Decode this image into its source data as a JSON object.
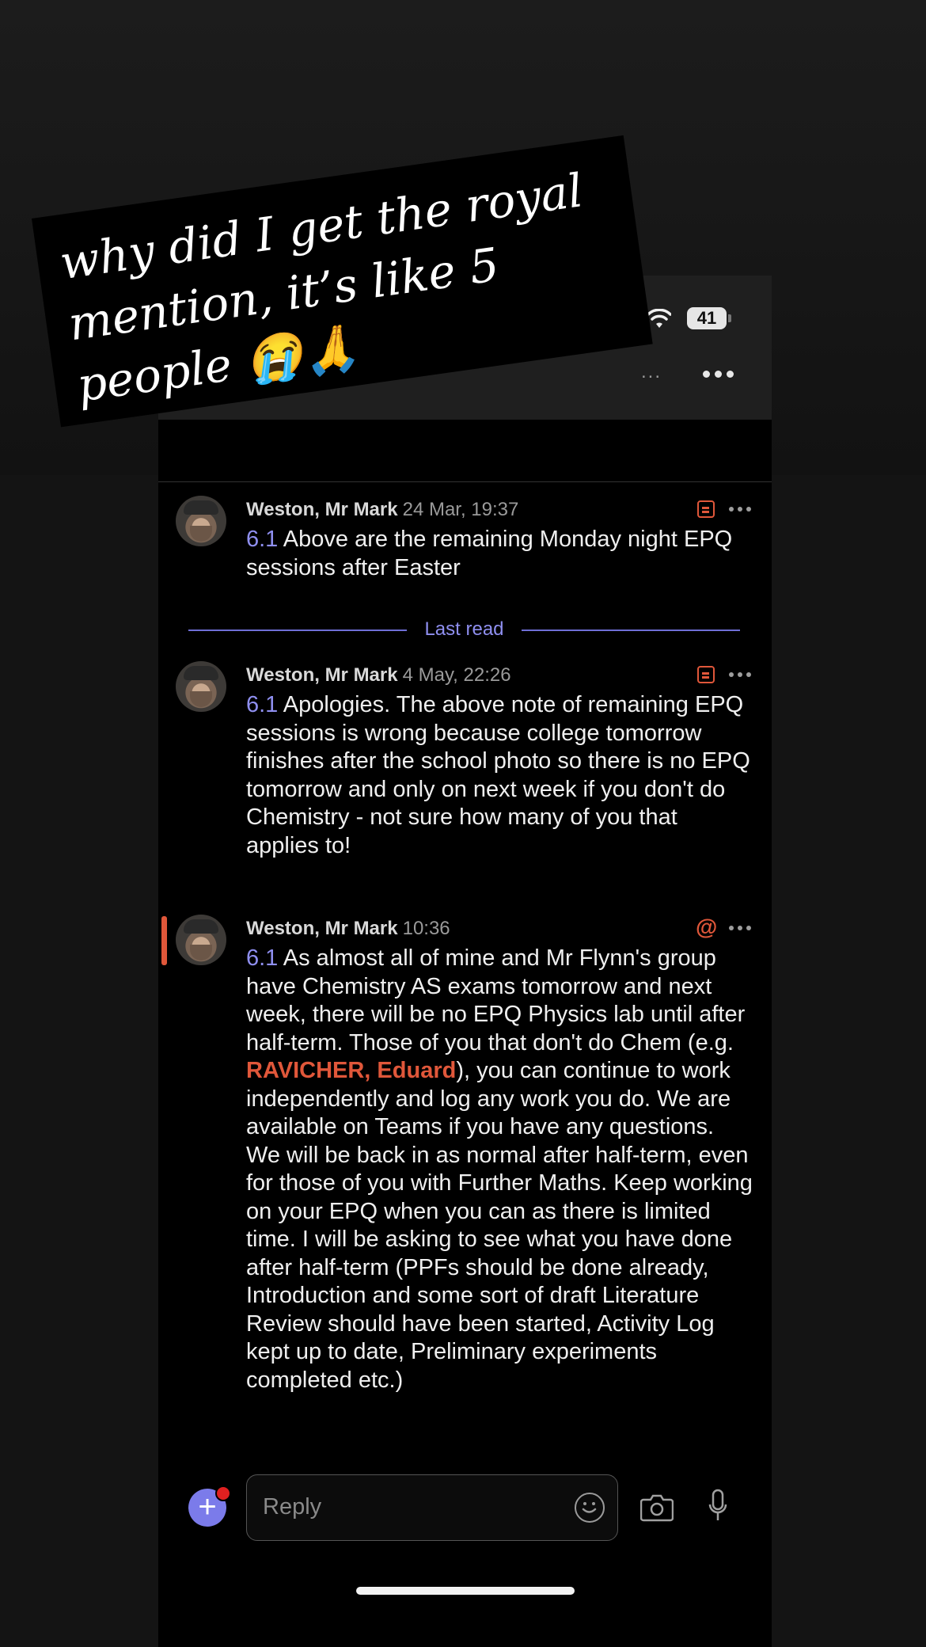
{
  "overlay": {
    "caption": "why did I get the royal mention, it’s like 5 people 😭🙏"
  },
  "status_bar": {
    "battery": "41"
  },
  "header": {
    "overflow_hint": "...",
    "more_icon": "more-horizontal-icon"
  },
  "messages": [
    {
      "author": "Weston, Mr Mark",
      "time": "24 Mar, 19:37",
      "tag": "6.1",
      "text": " Above are the remaining Monday night EPQ sessions after Easter",
      "icon": "note-icon"
    },
    {
      "author": "Weston, Mr Mark",
      "time": "4 May, 22:26",
      "tag": "6.1",
      "text": " Apologies. The above note of remaining EPQ sessions is wrong because college tomorrow finishes after the school photo so there is no EPQ tomorrow and only on next week if you don't do Chemistry - not sure how many of you that applies to!",
      "icon": "note-icon"
    },
    {
      "author": "Weston, Mr Mark",
      "time": "10:36",
      "tag": "6.1",
      "text_before": " As almost all of mine and Mr Flynn's group have Chemistry AS exams tomorrow and next week, there will be no EPQ Physics lab until after half-term. Those of you that don't do Chem (e.g. ",
      "mention": "RAVICHER, Eduard",
      "text_after": "), you can continue to work independently and log any work you do. We are available on Teams if you have any questions.\nWe will be back in as normal after half-term, even for those of you with Further Maths. Keep working on your EPQ when you can as there is limited time. I will be asking to see what you have done after half-term (PPFs should be done already, Introduction and some sort of draft Literature Review should have been started, Activity Log kept up to date, Preliminary experiments completed etc.)",
      "icon": "at-mention-icon",
      "at_symbol": "@"
    }
  ],
  "last_read_label": "Last read",
  "compose": {
    "placeholder": "Reply",
    "add_symbol": "+"
  },
  "colors": {
    "accent": "#7b7bea",
    "mention": "#e0573a",
    "background": "#000000"
  }
}
